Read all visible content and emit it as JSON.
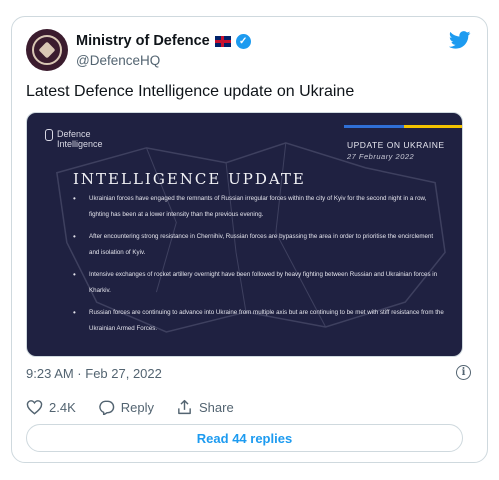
{
  "account": {
    "name": "Ministry of Defence",
    "handle": "@DefenceHQ"
  },
  "tweet": {
    "text": "Latest Defence Intelligence update on Ukraine",
    "timestamp": "9:23 AM · Feb 27, 2022"
  },
  "media": {
    "logo_line1": "Defence",
    "logo_line2": "Intelligence",
    "update_label": "UPDATE ON UKRAINE",
    "update_date": "27 February 2022",
    "title": "INTELLIGENCE UPDATE",
    "bullets": [
      "Ukrainian forces have engaged the remnants of Russian irregular forces within the city of Kyiv for the second night in a row, fighting has been at a lower intensity than the previous evening.",
      "After encountering strong resistance in Chernihiv, Russian forces are bypassing the area in order to prioritise the encirclement and isolation of Kyiv.",
      "Intensive exchanges of rocket artillery overnight have been followed by heavy fighting between Russian and Ukrainian forces in Kharkiv.",
      "Russian forces are continuing to advance into Ukraine from multiple axis but are continuing to be met with stiff resistance from the Ukrainian Armed Forces."
    ],
    "colors": {
      "background": "#1f2141",
      "flag_blue": "#2f6fd6",
      "flag_yellow": "#f2c200"
    }
  },
  "actions": {
    "likes": "2.4K",
    "reply_label": "Reply",
    "share_label": "Share"
  },
  "replies_button": "Read 44 replies",
  "icons": [
    "avatar-crest-icon",
    "uk-flag-icon",
    "verified-badge-icon",
    "twitter-bird-icon",
    "info-icon",
    "heart-icon",
    "reply-icon",
    "share-icon"
  ],
  "colors": {
    "accent": "#1d9bf0",
    "text": "#0f1419",
    "muted": "#536471"
  }
}
